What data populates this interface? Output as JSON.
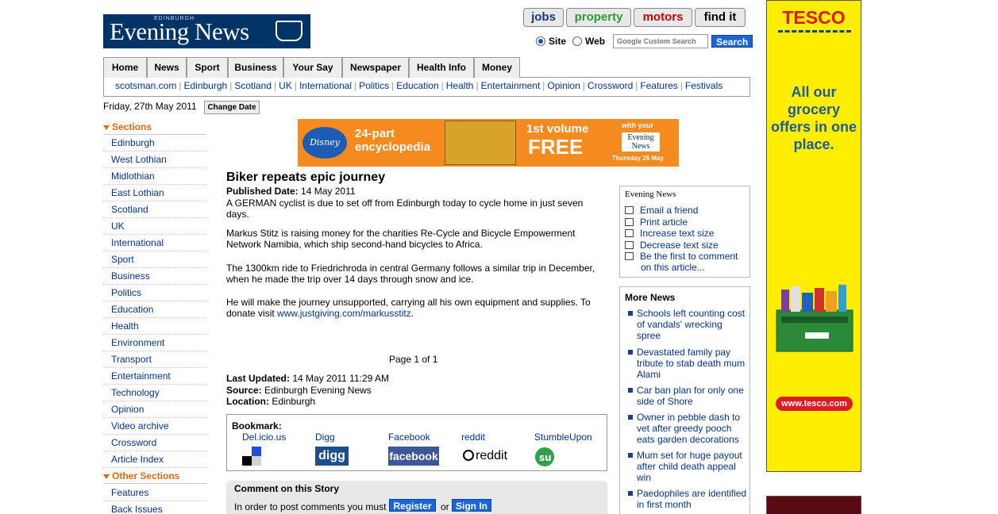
{
  "header": {
    "logo_small": "EDINBURGH",
    "logo_big": "Evening News",
    "top_buttons": [
      "jobs",
      "property",
      "motors",
      "find it"
    ],
    "search": {
      "opt_site": "Site",
      "opt_web": "Web",
      "placeholder": "Google Custom Search",
      "button": "Search"
    }
  },
  "main_nav": [
    "Home",
    "News",
    "Sport",
    "Business",
    "Your Say",
    "Newspaper",
    "Health Info",
    "Money"
  ],
  "sub_nav": [
    "scotsman.com",
    "Edinburgh",
    "Scotland",
    "UK",
    "International",
    "Politics",
    "Education",
    "Health",
    "Entertainment",
    "Opinion",
    "Crossword",
    "Features",
    "Festivals"
  ],
  "date": {
    "text": "Friday, 27th May 2011",
    "button": "Change Date"
  },
  "sidebar": {
    "sections_title": "Sections",
    "sections": [
      "Edinburgh",
      "West Lothian",
      "Midlothian",
      "East Lothian",
      "Scotland",
      "UK",
      "International",
      "Sport",
      "Business",
      "Politics",
      "Education",
      "Health",
      "Environment",
      "Transport",
      "Entertainment",
      "Technology",
      "Opinion",
      "Video archive",
      "Crossword",
      "Article Index"
    ],
    "other_title": "Other Sections",
    "other": [
      "Features",
      "Back Issues"
    ]
  },
  "banner": {
    "brand": "Disney",
    "line1": "24-part",
    "line2": "encyclopedia",
    "line3": "1st volume",
    "line4": "FREE",
    "line5": "with your",
    "paper": "Evening News",
    "date": "Thursday 26 May"
  },
  "article": {
    "headline": "Biker repeats epic journey",
    "published_label": "Published Date:",
    "published_date": "14 May 2011",
    "p1": "A GERMAN cyclist is due to set off from Edinburgh today to cycle home in just seven days.",
    "p2": "Markus Stitz is raising money for the charities Re-Cycle and Bicycle Empowerment Network Namibia, which ship second-hand bicycles to Africa.",
    "p3": "The 1300km ride to Friedrichroda in central Germany follows a similar trip in December, when he made the trip over 14 days through snow and ice.",
    "p4": "He will make the journey unsupported, carrying all his own equipment and supplies. To donate visit",
    "p4_link": "www.justgiving.com/markusstitz",
    "page_info": "Page 1 of 1",
    "updated_label": "Last Updated:",
    "updated": "14 May 2011 11:29 AM",
    "source_label": "Source:",
    "source": "Edinburgh Evening News",
    "location_label": "Location:",
    "location": "Edinburgh"
  },
  "bookmark": {
    "title": "Bookmark:",
    "sites": [
      "Del.icio.us",
      "Digg",
      "Facebook",
      "reddit",
      "StumbleUpon"
    ],
    "icons": [
      "digg",
      "facebook",
      "reddit"
    ]
  },
  "comment": {
    "title": "Comment on this Story",
    "text": "In order to post comments you must",
    "register": "Register",
    "or": "or",
    "signin": "Sign In"
  },
  "tools": {
    "logo": "Evening News",
    "items": [
      "Email a friend",
      "Print article",
      "Increase text size",
      "Decrease text size",
      "Be the first to comment on this article..."
    ]
  },
  "more_news": {
    "title": "More News",
    "items": [
      "Schools left counting cost of vandals' wrecking spree",
      "Devastated family pay tribute to stab death mum Alami",
      "Car ban plan for only one side of Shore",
      "Owner in pebble dash to vet after greedy pooch eats garden decorations",
      "Mum set for huge payout after child death appeal win",
      "Paedophiles are identified in first month"
    ]
  },
  "ad": {
    "brand": "TESCO",
    "message": "All our grocery offers in one place.",
    "url": "www.tesco.com"
  }
}
